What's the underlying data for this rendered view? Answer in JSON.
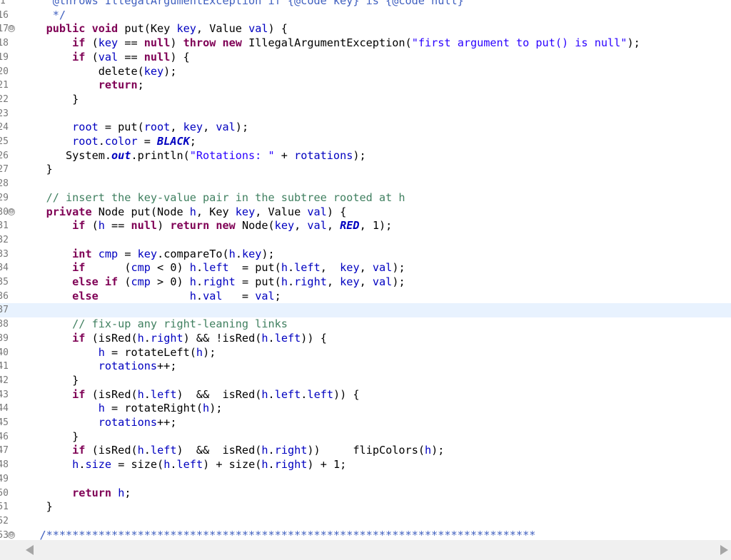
{
  "editor": {
    "current_line_index": 22,
    "lines": [
      {
        "n": "1",
        "fold": "",
        "segs": [
          [
            "jd",
            "     @throws IllegalArgumentException if {@code key} is {@code null}"
          ]
        ]
      },
      {
        "n": "16",
        "fold": "",
        "segs": [
          [
            "jd",
            "     */"
          ]
        ]
      },
      {
        "n": "17",
        "fold": "⊖",
        "segs": [
          [
            "",
            "    "
          ],
          [
            "kw",
            "public void"
          ],
          [
            "",
            " put(Key "
          ],
          [
            "v",
            "key"
          ],
          [
            "",
            ", Value "
          ],
          [
            "v",
            "val"
          ],
          [
            "",
            ") {"
          ]
        ]
      },
      {
        "n": "18",
        "fold": "",
        "segs": [
          [
            "",
            "        "
          ],
          [
            "kw",
            "if"
          ],
          [
            "",
            " ("
          ],
          [
            "v",
            "key"
          ],
          [
            "",
            " == "
          ],
          [
            "kw",
            "null"
          ],
          [
            "",
            ") "
          ],
          [
            "kw",
            "throw new"
          ],
          [
            "",
            " IllegalArgumentException("
          ],
          [
            "str",
            "\"first argument to put() is null\""
          ],
          [
            "",
            ");"
          ]
        ]
      },
      {
        "n": "19",
        "fold": "",
        "segs": [
          [
            "",
            "        "
          ],
          [
            "kw",
            "if"
          ],
          [
            "",
            " ("
          ],
          [
            "v",
            "val"
          ],
          [
            "",
            " == "
          ],
          [
            "kw",
            "null"
          ],
          [
            "",
            ") {"
          ]
        ]
      },
      {
        "n": "20",
        "fold": "",
        "segs": [
          [
            "",
            "            delete("
          ],
          [
            "v",
            "key"
          ],
          [
            "",
            ");"
          ]
        ]
      },
      {
        "n": "21",
        "fold": "",
        "segs": [
          [
            "",
            "            "
          ],
          [
            "kw",
            "return"
          ],
          [
            "",
            ";"
          ]
        ]
      },
      {
        "n": "22",
        "fold": "",
        "segs": [
          [
            "",
            "        }"
          ]
        ]
      },
      {
        "n": "23",
        "fold": "",
        "segs": []
      },
      {
        "n": "24",
        "fold": "",
        "segs": [
          [
            "",
            "        "
          ],
          [
            "v",
            "root"
          ],
          [
            "",
            " = put("
          ],
          [
            "v",
            "root"
          ],
          [
            "",
            ", "
          ],
          [
            "v",
            "key"
          ],
          [
            "",
            ", "
          ],
          [
            "v",
            "val"
          ],
          [
            "",
            ");"
          ]
        ]
      },
      {
        "n": "25",
        "fold": "",
        "segs": [
          [
            "",
            "        "
          ],
          [
            "v",
            "root"
          ],
          [
            "",
            "."
          ],
          [
            "v",
            "color"
          ],
          [
            "",
            " = "
          ],
          [
            "sf",
            "BLACK"
          ],
          [
            "",
            ";"
          ]
        ]
      },
      {
        "n": "26",
        "fold": "",
        "segs": [
          [
            "",
            "       System."
          ],
          [
            "st",
            "out"
          ],
          [
            "",
            ".println("
          ],
          [
            "str",
            "\"Rotations: \""
          ],
          [
            "",
            " + "
          ],
          [
            "v",
            "rotations"
          ],
          [
            "",
            ");"
          ]
        ]
      },
      {
        "n": "27",
        "fold": "",
        "segs": [
          [
            "",
            "    }"
          ]
        ]
      },
      {
        "n": "28",
        "fold": "",
        "segs": []
      },
      {
        "n": "29",
        "fold": "",
        "segs": [
          [
            "",
            "    "
          ],
          [
            "cm",
            "// insert the key-value pair in the subtree rooted at h"
          ]
        ]
      },
      {
        "n": "30",
        "fold": "⊖",
        "segs": [
          [
            "",
            "    "
          ],
          [
            "kw",
            "private"
          ],
          [
            "",
            " Node put(Node "
          ],
          [
            "v",
            "h"
          ],
          [
            "",
            ", Key "
          ],
          [
            "v",
            "key"
          ],
          [
            "",
            ", Value "
          ],
          [
            "v",
            "val"
          ],
          [
            "",
            ") {"
          ]
        ]
      },
      {
        "n": "31",
        "fold": "",
        "segs": [
          [
            "",
            "        "
          ],
          [
            "kw",
            "if"
          ],
          [
            "",
            " ("
          ],
          [
            "v",
            "h"
          ],
          [
            "",
            " == "
          ],
          [
            "kw",
            "null"
          ],
          [
            "",
            ") "
          ],
          [
            "kw",
            "return new"
          ],
          [
            "",
            " Node("
          ],
          [
            "v",
            "key"
          ],
          [
            "",
            ", "
          ],
          [
            "v",
            "val"
          ],
          [
            "",
            ", "
          ],
          [
            "sf",
            "RED"
          ],
          [
            "",
            ", 1);"
          ]
        ]
      },
      {
        "n": "32",
        "fold": "",
        "segs": []
      },
      {
        "n": "33",
        "fold": "",
        "segs": [
          [
            "",
            "        "
          ],
          [
            "kw",
            "int"
          ],
          [
            "",
            " "
          ],
          [
            "v",
            "cmp"
          ],
          [
            "",
            " = "
          ],
          [
            "v",
            "key"
          ],
          [
            "",
            ".compareTo("
          ],
          [
            "v",
            "h"
          ],
          [
            "",
            "."
          ],
          [
            "v",
            "key"
          ],
          [
            "",
            ");"
          ]
        ]
      },
      {
        "n": "34",
        "fold": "",
        "segs": [
          [
            "",
            "        "
          ],
          [
            "kw",
            "if"
          ],
          [
            "",
            "      ("
          ],
          [
            "v",
            "cmp"
          ],
          [
            "",
            " < 0) "
          ],
          [
            "v",
            "h"
          ],
          [
            "",
            "."
          ],
          [
            "v",
            "left"
          ],
          [
            "",
            "  = put("
          ],
          [
            "v",
            "h"
          ],
          [
            "",
            "."
          ],
          [
            "v",
            "left"
          ],
          [
            "",
            ",  "
          ],
          [
            "v",
            "key"
          ],
          [
            "",
            ", "
          ],
          [
            "v",
            "val"
          ],
          [
            "",
            ");"
          ]
        ]
      },
      {
        "n": "35",
        "fold": "",
        "segs": [
          [
            "",
            "        "
          ],
          [
            "kw",
            "else if"
          ],
          [
            "",
            " ("
          ],
          [
            "v",
            "cmp"
          ],
          [
            "",
            " > 0) "
          ],
          [
            "v",
            "h"
          ],
          [
            "",
            "."
          ],
          [
            "v",
            "right"
          ],
          [
            "",
            " = put("
          ],
          [
            "v",
            "h"
          ],
          [
            "",
            "."
          ],
          [
            "v",
            "right"
          ],
          [
            "",
            ", "
          ],
          [
            "v",
            "key"
          ],
          [
            "",
            ", "
          ],
          [
            "v",
            "val"
          ],
          [
            "",
            ");"
          ]
        ]
      },
      {
        "n": "36",
        "fold": "",
        "segs": [
          [
            "",
            "        "
          ],
          [
            "kw",
            "else"
          ],
          [
            "",
            "              "
          ],
          [
            "v",
            "h"
          ],
          [
            "",
            "."
          ],
          [
            "v",
            "val"
          ],
          [
            "",
            "   = "
          ],
          [
            "v",
            "val"
          ],
          [
            "",
            ";"
          ]
        ]
      },
      {
        "n": "37",
        "fold": "",
        "segs": []
      },
      {
        "n": "38",
        "fold": "",
        "segs": [
          [
            "",
            "        "
          ],
          [
            "cm",
            "// fix-up any right-leaning links"
          ]
        ]
      },
      {
        "n": "39",
        "fold": "",
        "segs": [
          [
            "",
            "        "
          ],
          [
            "kw",
            "if"
          ],
          [
            "",
            " (isRed("
          ],
          [
            "v",
            "h"
          ],
          [
            "",
            "."
          ],
          [
            "v",
            "right"
          ],
          [
            "",
            ") && !isRed("
          ],
          [
            "v",
            "h"
          ],
          [
            "",
            "."
          ],
          [
            "v",
            "left"
          ],
          [
            "",
            ")) {"
          ]
        ]
      },
      {
        "n": "40",
        "fold": "",
        "segs": [
          [
            "",
            "            "
          ],
          [
            "v",
            "h"
          ],
          [
            "",
            " = rotateLeft("
          ],
          [
            "v",
            "h"
          ],
          [
            "",
            ");"
          ]
        ]
      },
      {
        "n": "41",
        "fold": "",
        "segs": [
          [
            "",
            "            "
          ],
          [
            "v",
            "rotations"
          ],
          [
            "",
            "++;"
          ]
        ]
      },
      {
        "n": "42",
        "fold": "",
        "segs": [
          [
            "",
            "        }"
          ]
        ]
      },
      {
        "n": "43",
        "fold": "",
        "segs": [
          [
            "",
            "        "
          ],
          [
            "kw",
            "if"
          ],
          [
            "",
            " (isRed("
          ],
          [
            "v",
            "h"
          ],
          [
            "",
            "."
          ],
          [
            "v",
            "left"
          ],
          [
            "",
            ")  &&  isRed("
          ],
          [
            "v",
            "h"
          ],
          [
            "",
            "."
          ],
          [
            "v",
            "left"
          ],
          [
            "",
            "."
          ],
          [
            "v",
            "left"
          ],
          [
            "",
            ")) {"
          ]
        ]
      },
      {
        "n": "44",
        "fold": "",
        "segs": [
          [
            "",
            "            "
          ],
          [
            "v",
            "h"
          ],
          [
            "",
            " = rotateRight("
          ],
          [
            "v",
            "h"
          ],
          [
            "",
            ");"
          ]
        ]
      },
      {
        "n": "45",
        "fold": "",
        "segs": [
          [
            "",
            "            "
          ],
          [
            "v",
            "rotations"
          ],
          [
            "",
            "++;"
          ]
        ]
      },
      {
        "n": "46",
        "fold": "",
        "segs": [
          [
            "",
            "        }"
          ]
        ]
      },
      {
        "n": "47",
        "fold": "",
        "segs": [
          [
            "",
            "        "
          ],
          [
            "kw",
            "if"
          ],
          [
            "",
            " (isRed("
          ],
          [
            "v",
            "h"
          ],
          [
            "",
            "."
          ],
          [
            "v",
            "left"
          ],
          [
            "",
            ")  &&  isRed("
          ],
          [
            "v",
            "h"
          ],
          [
            "",
            "."
          ],
          [
            "v",
            "right"
          ],
          [
            "",
            "))     flipColors("
          ],
          [
            "v",
            "h"
          ],
          [
            "",
            ");"
          ]
        ]
      },
      {
        "n": "48",
        "fold": "",
        "segs": [
          [
            "",
            "        "
          ],
          [
            "v",
            "h"
          ],
          [
            "",
            "."
          ],
          [
            "v",
            "size"
          ],
          [
            "",
            " = size("
          ],
          [
            "v",
            "h"
          ],
          [
            "",
            "."
          ],
          [
            "v",
            "left"
          ],
          [
            "",
            ") + size("
          ],
          [
            "v",
            "h"
          ],
          [
            "",
            "."
          ],
          [
            "v",
            "right"
          ],
          [
            "",
            ") + 1;"
          ]
        ]
      },
      {
        "n": "49",
        "fold": "",
        "segs": []
      },
      {
        "n": "50",
        "fold": "",
        "segs": [
          [
            "",
            "        "
          ],
          [
            "kw",
            "return"
          ],
          [
            "",
            " "
          ],
          [
            "v",
            "h"
          ],
          [
            "",
            ";"
          ]
        ]
      },
      {
        "n": "51",
        "fold": "",
        "segs": [
          [
            "",
            "    }"
          ]
        ]
      },
      {
        "n": "52",
        "fold": "",
        "segs": []
      },
      {
        "n": "53",
        "fold": "⊖",
        "segs": [
          [
            "",
            "   "
          ],
          [
            "jd",
            "/***************************************************************************"
          ]
        ]
      }
    ]
  },
  "scrollbar": {
    "left_icon": "arrow-left-icon",
    "right_icon": "arrow-right-icon"
  }
}
